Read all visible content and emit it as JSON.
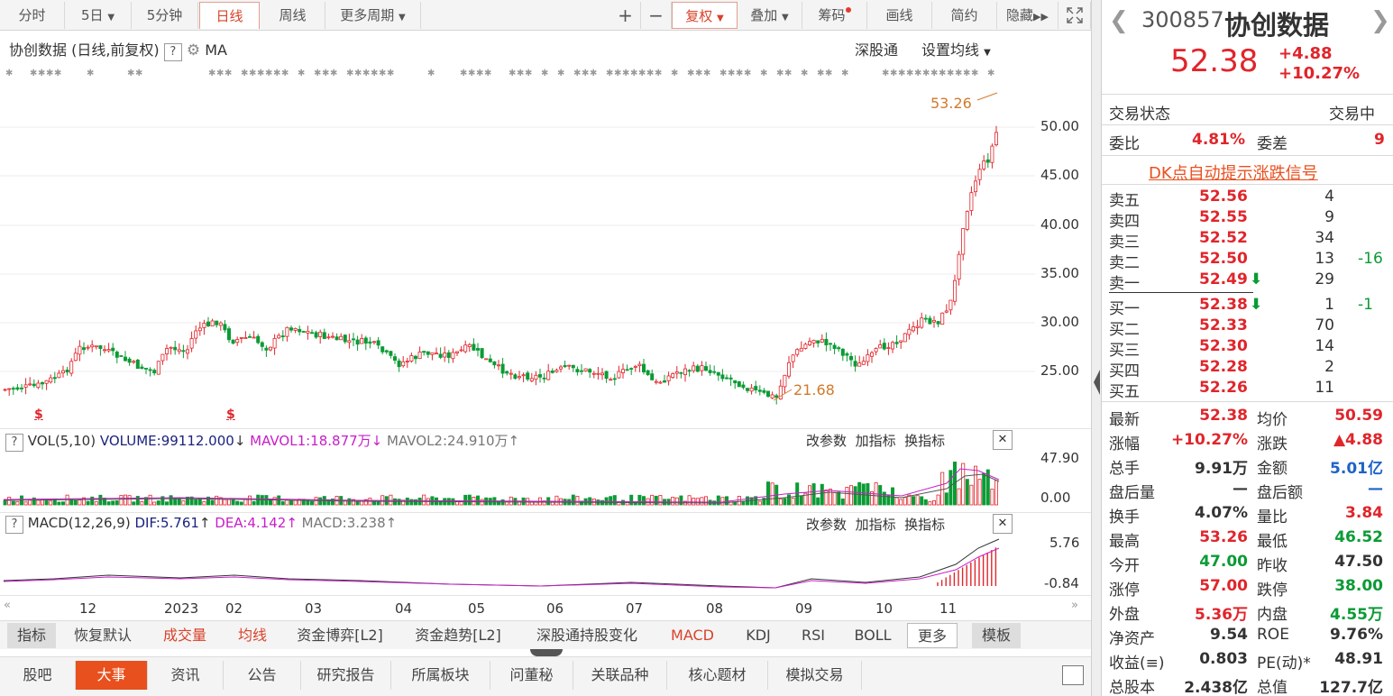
{
  "toolbar": {
    "left": [
      "分时",
      "5日",
      "5分钟",
      "日线",
      "周线",
      "更多周期"
    ],
    "right": [
      "复权",
      "叠加",
      "筹码",
      "画线",
      "简约",
      "隐藏"
    ],
    "active": "日线"
  },
  "chart_header": {
    "title": "协创数据 (日线,前复权)",
    "ma": "MA",
    "shgt": "深股通",
    "set_ma": "设置均线"
  },
  "price_axis": {
    "ticks": [
      "50.00",
      "45.00",
      "40.00",
      "35.00",
      "30.00",
      "25.00"
    ],
    "high_label": "53.26",
    "low_label": "21.68"
  },
  "volume_pane": {
    "name": "VOL(5,10)",
    "volume": "VOLUME:99112.000",
    "mavol1": "MAVOL1:18.877万",
    "mavol2": "MAVOL2:24.910万",
    "top_tick": "47.90",
    "bottom_tick": "0.00",
    "actions": [
      "改参数",
      "加指标",
      "换指标"
    ]
  },
  "macd_pane": {
    "name": "MACD(12,26,9)",
    "dif": "DIF:5.761",
    "dea": "DEA:4.142",
    "macd": "MACD:3.238",
    "top_tick": "5.76",
    "bottom_tick": "-0.84",
    "actions": [
      "改参数",
      "加指标",
      "换指标"
    ]
  },
  "x_axis": [
    "12",
    "2023",
    "02",
    "03",
    "04",
    "05",
    "06",
    "07",
    "08",
    "09",
    "10",
    "11"
  ],
  "indicator_bar": [
    "指标",
    "恢复默认",
    "成交量",
    "均线",
    "资金博弈[L2]",
    "资金趋势[L2]",
    "深股通持股变化",
    "MACD",
    "KDJ",
    "RSI",
    "BOLL",
    "更多",
    "模板"
  ],
  "bottom_tabs": [
    "股吧",
    "大事",
    "资讯",
    "公告",
    "研究报告",
    "所属板块",
    "问董秘",
    "关联品种",
    "核心题材",
    "模拟交易"
  ],
  "bottom_tab_active": "大事",
  "stock": {
    "code": "300857",
    "name": "协创数据",
    "price": "52.38",
    "change": "+4.88",
    "change_pct": "+10.27%",
    "status_label": "交易状态",
    "status_value": "交易中",
    "weibi_label": "委比",
    "weibi": "4.81%",
    "weicha_label": "委差",
    "weicha": "9",
    "dk_link": "DK点自动提示涨跌信号"
  },
  "order_book": {
    "sell": [
      {
        "label": "卖五",
        "price": "52.56",
        "vol": "4",
        "chg": ""
      },
      {
        "label": "卖四",
        "price": "52.55",
        "vol": "9",
        "chg": ""
      },
      {
        "label": "卖三",
        "price": "52.52",
        "vol": "34",
        "chg": ""
      },
      {
        "label": "卖二",
        "price": "52.50",
        "vol": "13",
        "chg": "-16"
      },
      {
        "label": "卖一",
        "price": "52.49",
        "vol": "29",
        "chg": ""
      }
    ],
    "buy": [
      {
        "label": "买一",
        "price": "52.38",
        "vol": "1",
        "chg": "-1"
      },
      {
        "label": "买二",
        "price": "52.33",
        "vol": "70",
        "chg": ""
      },
      {
        "label": "买三",
        "price": "52.30",
        "vol": "14",
        "chg": ""
      },
      {
        "label": "买四",
        "price": "52.28",
        "vol": "2",
        "chg": ""
      },
      {
        "label": "买五",
        "price": "52.26",
        "vol": "11",
        "chg": ""
      }
    ]
  },
  "quote": [
    {
      "l": "最新",
      "v": "52.38",
      "c": "red",
      "l2": "均价",
      "v2": "50.59",
      "c2": "red"
    },
    {
      "l": "涨幅",
      "v": "+10.27%",
      "c": "red",
      "l2": "涨跌",
      "v2": "▲4.88",
      "c2": "red"
    },
    {
      "l": "总手",
      "v": "9.91万",
      "c": "",
      "l2": "金额",
      "v2": "5.01亿",
      "c2": "blue"
    },
    {
      "l": "盘后量",
      "v": "—",
      "c": "",
      "l2": "盘后额",
      "v2": "—",
      "c2": "blue"
    },
    {
      "l": "换手",
      "v": "4.07%",
      "c": "",
      "l2": "量比",
      "v2": "3.84",
      "c2": "red"
    },
    {
      "l": "最高",
      "v": "53.26",
      "c": "red",
      "l2": "最低",
      "v2": "46.52",
      "c2": "green"
    },
    {
      "l": "今开",
      "v": "47.00",
      "c": "green",
      "l2": "昨收",
      "v2": "47.50",
      "c2": ""
    },
    {
      "l": "涨停",
      "v": "57.00",
      "c": "red",
      "l2": "跌停",
      "v2": "38.00",
      "c2": "green"
    },
    {
      "l": "外盘",
      "v": "5.36万",
      "c": "red",
      "l2": "内盘",
      "v2": "4.55万",
      "c2": "green"
    },
    {
      "l": "净资产",
      "v": "9.54",
      "c": "",
      "l2": "ROE",
      "v2": "9.76%",
      "c2": ""
    },
    {
      "l": "收益(≡)",
      "v": "0.803",
      "c": "",
      "l2": "PE(动)*",
      "v2": "48.91",
      "c2": ""
    },
    {
      "l": "总股本",
      "v": "2.438亿",
      "c": "",
      "l2": "总值",
      "v2": "127.7亿",
      "c2": ""
    }
  ],
  "colors": {
    "up": "#e0252b",
    "down": "#0b9b35",
    "accent": "#e8501e",
    "ma_purple": "#b03cc8"
  }
}
